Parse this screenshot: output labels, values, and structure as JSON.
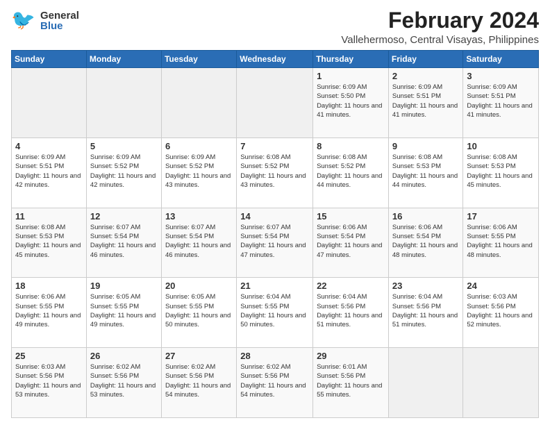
{
  "header": {
    "logo_general": "General",
    "logo_blue": "Blue",
    "title": "February 2024",
    "location": "Vallehermoso, Central Visayas, Philippines"
  },
  "columns": [
    "Sunday",
    "Monday",
    "Tuesday",
    "Wednesday",
    "Thursday",
    "Friday",
    "Saturday"
  ],
  "weeks": [
    {
      "days": [
        {
          "num": "",
          "info": ""
        },
        {
          "num": "",
          "info": ""
        },
        {
          "num": "",
          "info": ""
        },
        {
          "num": "",
          "info": ""
        },
        {
          "num": "1",
          "info": "Sunrise: 6:09 AM\nSunset: 5:50 PM\nDaylight: 11 hours\nand 41 minutes."
        },
        {
          "num": "2",
          "info": "Sunrise: 6:09 AM\nSunset: 5:51 PM\nDaylight: 11 hours\nand 41 minutes."
        },
        {
          "num": "3",
          "info": "Sunrise: 6:09 AM\nSunset: 5:51 PM\nDaylight: 11 hours\nand 41 minutes."
        }
      ]
    },
    {
      "days": [
        {
          "num": "4",
          "info": "Sunrise: 6:09 AM\nSunset: 5:51 PM\nDaylight: 11 hours\nand 42 minutes."
        },
        {
          "num": "5",
          "info": "Sunrise: 6:09 AM\nSunset: 5:52 PM\nDaylight: 11 hours\nand 42 minutes."
        },
        {
          "num": "6",
          "info": "Sunrise: 6:09 AM\nSunset: 5:52 PM\nDaylight: 11 hours\nand 43 minutes."
        },
        {
          "num": "7",
          "info": "Sunrise: 6:08 AM\nSunset: 5:52 PM\nDaylight: 11 hours\nand 43 minutes."
        },
        {
          "num": "8",
          "info": "Sunrise: 6:08 AM\nSunset: 5:52 PM\nDaylight: 11 hours\nand 44 minutes."
        },
        {
          "num": "9",
          "info": "Sunrise: 6:08 AM\nSunset: 5:53 PM\nDaylight: 11 hours\nand 44 minutes."
        },
        {
          "num": "10",
          "info": "Sunrise: 6:08 AM\nSunset: 5:53 PM\nDaylight: 11 hours\nand 45 minutes."
        }
      ]
    },
    {
      "days": [
        {
          "num": "11",
          "info": "Sunrise: 6:08 AM\nSunset: 5:53 PM\nDaylight: 11 hours\nand 45 minutes."
        },
        {
          "num": "12",
          "info": "Sunrise: 6:07 AM\nSunset: 5:54 PM\nDaylight: 11 hours\nand 46 minutes."
        },
        {
          "num": "13",
          "info": "Sunrise: 6:07 AM\nSunset: 5:54 PM\nDaylight: 11 hours\nand 46 minutes."
        },
        {
          "num": "14",
          "info": "Sunrise: 6:07 AM\nSunset: 5:54 PM\nDaylight: 11 hours\nand 47 minutes."
        },
        {
          "num": "15",
          "info": "Sunrise: 6:06 AM\nSunset: 5:54 PM\nDaylight: 11 hours\nand 47 minutes."
        },
        {
          "num": "16",
          "info": "Sunrise: 6:06 AM\nSunset: 5:54 PM\nDaylight: 11 hours\nand 48 minutes."
        },
        {
          "num": "17",
          "info": "Sunrise: 6:06 AM\nSunset: 5:55 PM\nDaylight: 11 hours\nand 48 minutes."
        }
      ]
    },
    {
      "days": [
        {
          "num": "18",
          "info": "Sunrise: 6:06 AM\nSunset: 5:55 PM\nDaylight: 11 hours\nand 49 minutes."
        },
        {
          "num": "19",
          "info": "Sunrise: 6:05 AM\nSunset: 5:55 PM\nDaylight: 11 hours\nand 49 minutes."
        },
        {
          "num": "20",
          "info": "Sunrise: 6:05 AM\nSunset: 5:55 PM\nDaylight: 11 hours\nand 50 minutes."
        },
        {
          "num": "21",
          "info": "Sunrise: 6:04 AM\nSunset: 5:55 PM\nDaylight: 11 hours\nand 50 minutes."
        },
        {
          "num": "22",
          "info": "Sunrise: 6:04 AM\nSunset: 5:56 PM\nDaylight: 11 hours\nand 51 minutes."
        },
        {
          "num": "23",
          "info": "Sunrise: 6:04 AM\nSunset: 5:56 PM\nDaylight: 11 hours\nand 51 minutes."
        },
        {
          "num": "24",
          "info": "Sunrise: 6:03 AM\nSunset: 5:56 PM\nDaylight: 11 hours\nand 52 minutes."
        }
      ]
    },
    {
      "days": [
        {
          "num": "25",
          "info": "Sunrise: 6:03 AM\nSunset: 5:56 PM\nDaylight: 11 hours\nand 53 minutes."
        },
        {
          "num": "26",
          "info": "Sunrise: 6:02 AM\nSunset: 5:56 PM\nDaylight: 11 hours\nand 53 minutes."
        },
        {
          "num": "27",
          "info": "Sunrise: 6:02 AM\nSunset: 5:56 PM\nDaylight: 11 hours\nand 54 minutes."
        },
        {
          "num": "28",
          "info": "Sunrise: 6:02 AM\nSunset: 5:56 PM\nDaylight: 11 hours\nand 54 minutes."
        },
        {
          "num": "29",
          "info": "Sunrise: 6:01 AM\nSunset: 5:56 PM\nDaylight: 11 hours\nand 55 minutes."
        },
        {
          "num": "",
          "info": ""
        },
        {
          "num": "",
          "info": ""
        }
      ]
    }
  ]
}
